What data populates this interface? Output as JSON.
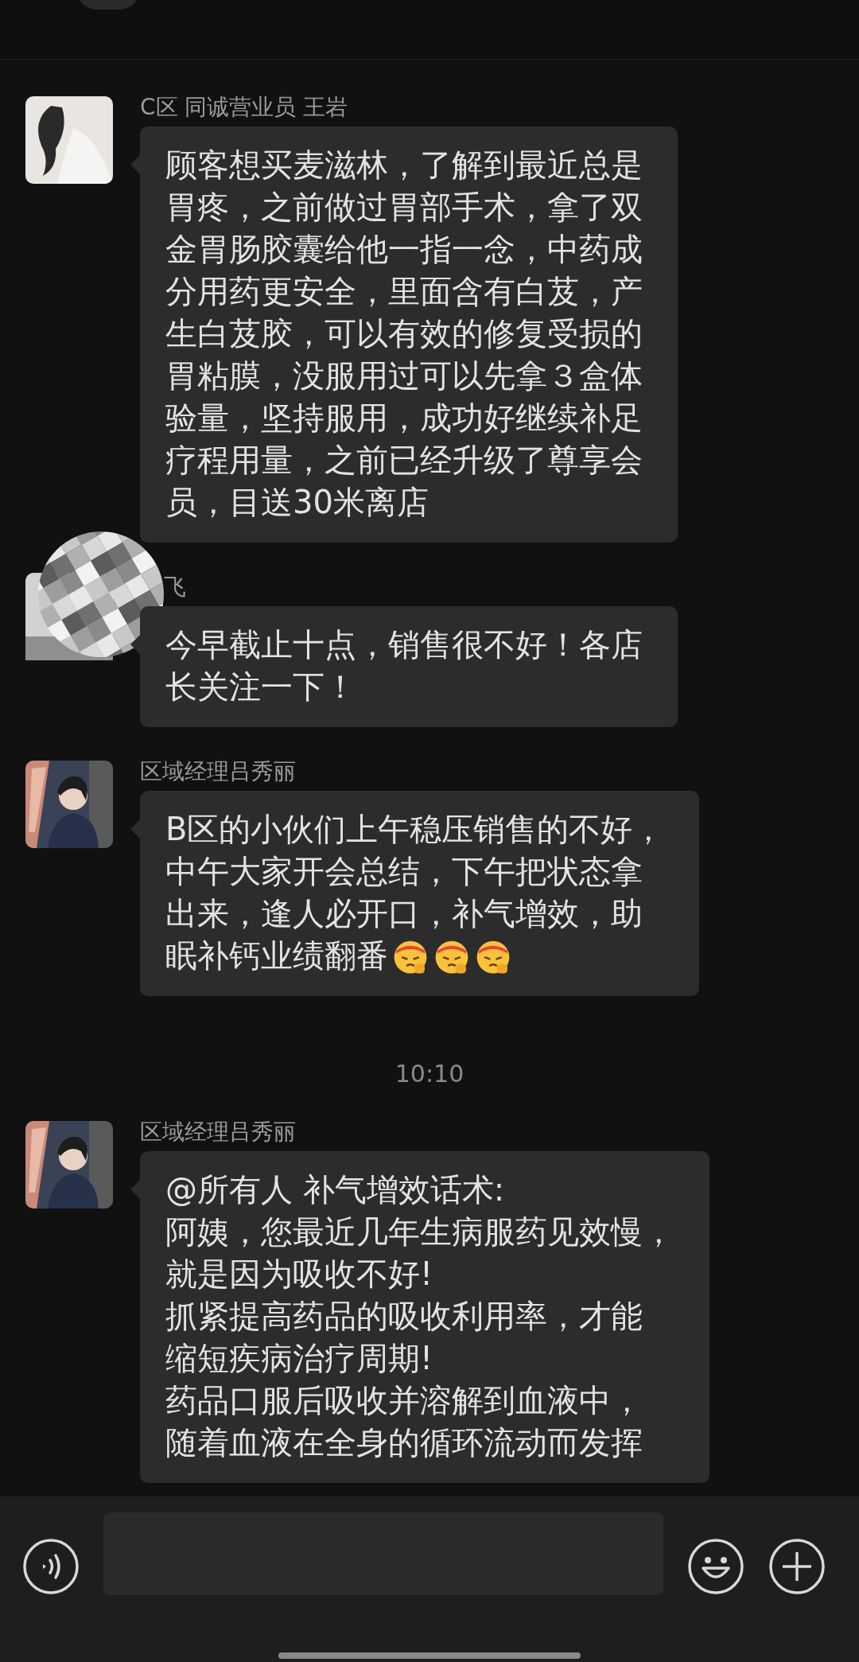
{
  "messages": [
    {
      "kind": "text",
      "sender": "C区 同诚营业员 王岩",
      "covered": false,
      "lines": [
        "顾客想买麦滋林，了解到最近总是",
        "胃疼，之前做过胃部手术，拿了双",
        "金胃肠胶囊给他一指一念，中药成",
        "分用药更安全，里面含有白芨，产",
        "生白芨胶，可以有效的修复受损的",
        "胃粘膜，没服用过可以先拿３盒体",
        "验量，坚持服用，成功好继续补足",
        "疗程用量，之前已经升级了尊享会",
        "员，目送30米离店"
      ]
    },
    {
      "kind": "text",
      "sender": "飞",
      "covered": true,
      "lines": [
        "今早截止十点，销售很不好！各店",
        "长关注一下！"
      ]
    },
    {
      "kind": "text_emoji",
      "sender": "区域经理吕秀丽",
      "covered": false,
      "lines": [
        "B区的小伙们上午稳压销售的不好，",
        "中午大家开会总结，下午把状态拿",
        "出来，逢人必开口，补气增效，助",
        "眠补钙业绩翻番"
      ]
    },
    {
      "kind": "time",
      "text": "10:10"
    },
    {
      "kind": "text",
      "sender": "区域经理吕秀丽",
      "covered": false,
      "lines": [
        "@所有人 补气增效话术:",
        "阿姨，您最近几年生病服药见效慢，",
        "就是因为吸收不好!",
        "抓紧提高药品的吸收利用率，才能",
        "缩短疾病治疗周期!",
        "药品口服后吸收并溶解到血液中，",
        "随着血液在全身的循环流动而发挥"
      ]
    }
  ]
}
